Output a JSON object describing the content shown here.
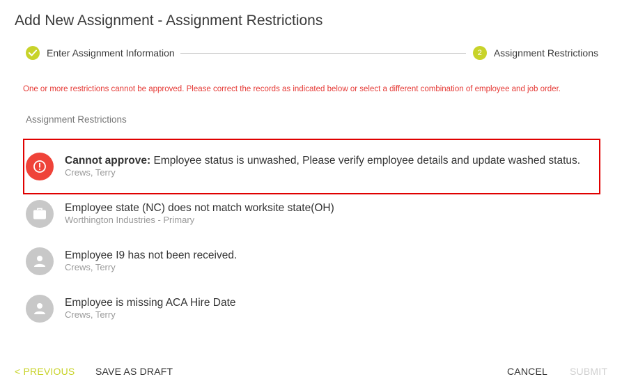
{
  "dialog": {
    "title": "Add New Assignment - Assignment Restrictions"
  },
  "stepper": {
    "steps": [
      {
        "label": "Enter Assignment Information",
        "status": "complete",
        "icon": "check-icon"
      },
      {
        "label": "Assignment Restrictions",
        "status": "active",
        "number": "2"
      }
    ],
    "accent_color": "#c8d32a"
  },
  "error_message": "One or more restrictions cannot be approved. Please correct the records as indicated below or select a different combination of employee and job order.",
  "section_label": "Assignment Restrictions",
  "restrictions": [
    {
      "prefix": "Cannot approve:",
      "message": " Employee status is unwashed, Please verify employee details and update washed status.",
      "subtitle": "Crews, Terry",
      "icon": "alert-circle-icon",
      "severity": "error"
    },
    {
      "message": "Employee state (NC) does not match worksite state(OH)",
      "subtitle": "Worthington Industries - Primary",
      "icon": "briefcase-icon",
      "severity": "warning"
    },
    {
      "message": "Employee I9 has not been received.",
      "subtitle": "Crews, Terry",
      "icon": "person-icon",
      "severity": "warning"
    },
    {
      "message": "Employee is missing ACA Hire Date",
      "subtitle": "Crews, Terry",
      "icon": "person-icon",
      "severity": "warning"
    }
  ],
  "footer": {
    "previous_label": "< PREVIOUS",
    "save_draft_label": "SAVE AS DRAFT",
    "cancel_label": "CANCEL",
    "submit_label": "SUBMIT"
  },
  "colors": {
    "error": "#ef4339",
    "highlight_border": "#e00000",
    "disabled": "#cfcfcf"
  }
}
